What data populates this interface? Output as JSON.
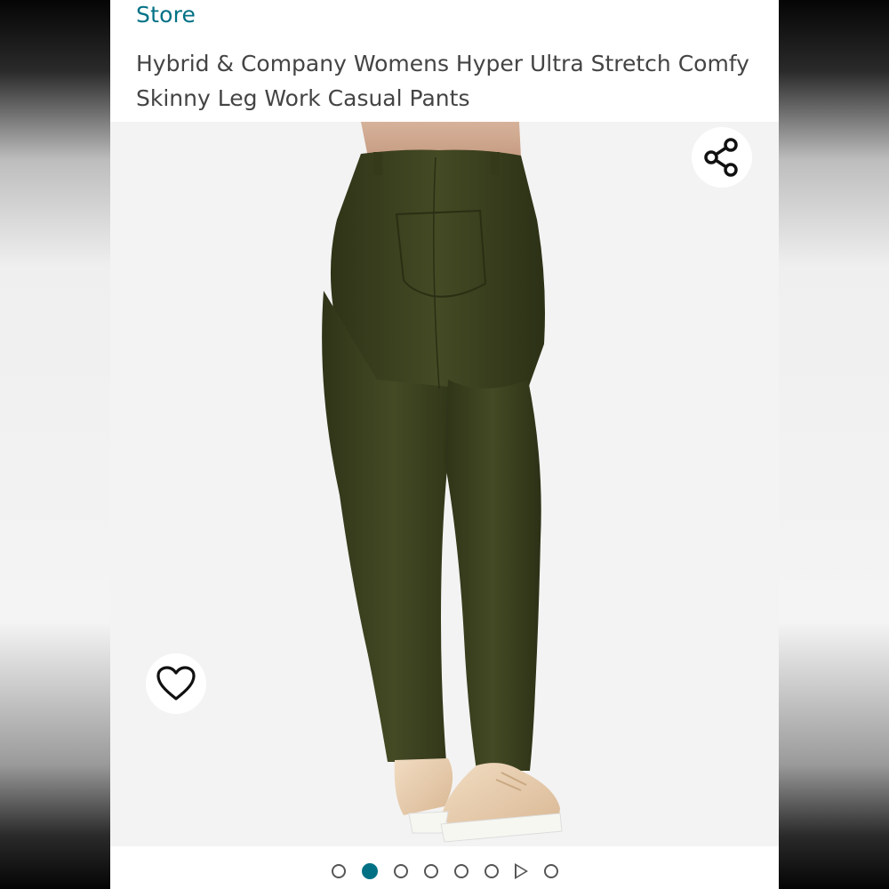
{
  "header": {
    "store_link": "Store",
    "product_title": "Hybrid & Company Womens Hyper Ultra Stretch Comfy Skinny Leg Work Casual Pants"
  },
  "image": {
    "subject": "olive green skinny pants, back view",
    "pants_color": "#3d4220",
    "shoe_color": "#e6c9a8",
    "background_color": "#f3f3f3"
  },
  "icons": {
    "share": "share-icon",
    "wishlist": "heart-icon",
    "video": "play-icon"
  },
  "carousel": {
    "total_items": 8,
    "active_index": 1,
    "accent_color": "#007185"
  }
}
